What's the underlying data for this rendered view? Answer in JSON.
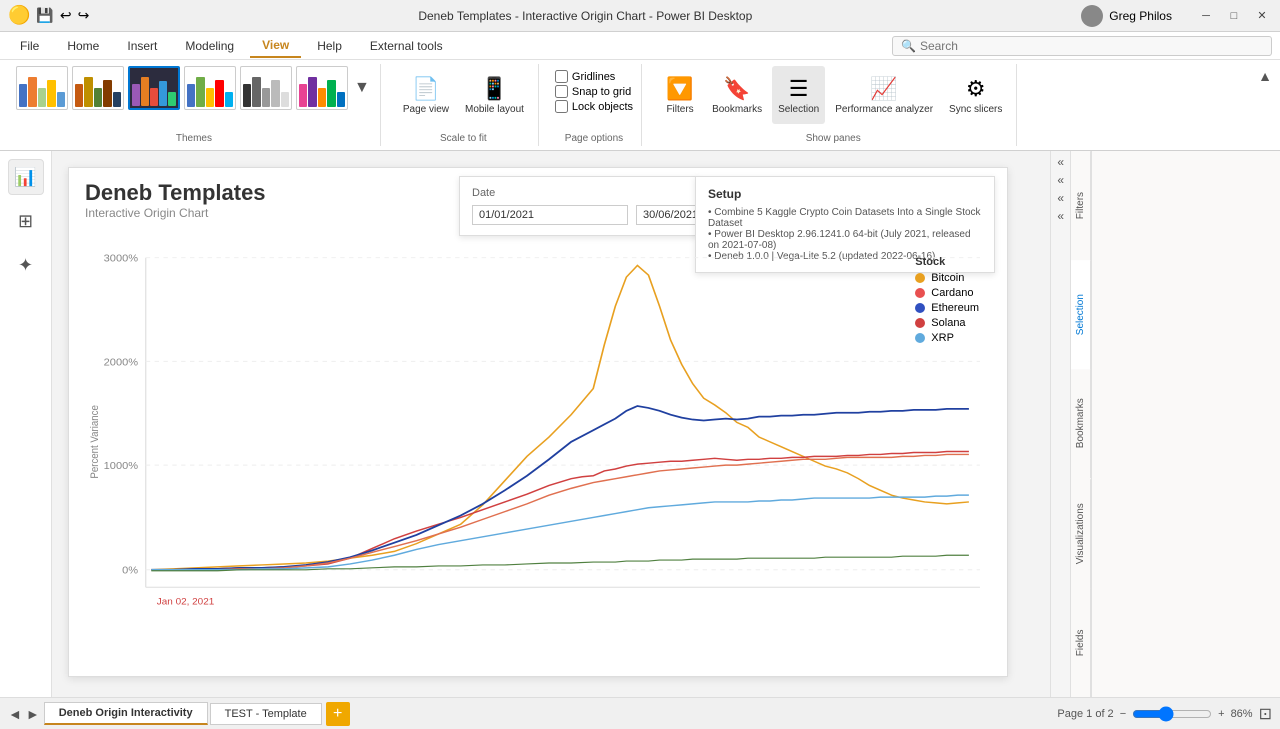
{
  "titleBar": {
    "title": "Deneb Templates - Interactive Origin Chart - Power BI Desktop",
    "user": "Greg Philos",
    "buttons": {
      "minimize": "─",
      "restore": "□",
      "close": "✕"
    }
  },
  "ribbon": {
    "tabs": [
      "File",
      "Home",
      "Insert",
      "Modeling",
      "View",
      "Help",
      "External tools"
    ],
    "activeTab": "View",
    "groups": {
      "themes": {
        "label": "Themes",
        "dropdown": "▼"
      },
      "scaleToFit": {
        "label": "Scale to fit",
        "buttons": [
          {
            "icon": "📄",
            "label": "Page\nview"
          },
          {
            "icon": "📱",
            "label": "Mobile\nlayout"
          }
        ]
      },
      "pageOptions": {
        "label": "Page options",
        "checkboxes": [
          "Gridlines",
          "Snap to grid",
          "Lock objects"
        ]
      },
      "showPanes": {
        "label": "Show panes",
        "buttons": [
          "Filters",
          "Bookmarks",
          "Selection",
          "Performance\nanalyzer",
          "Sync\nslicers"
        ]
      }
    }
  },
  "search": {
    "placeholder": "Search",
    "value": ""
  },
  "leftSidebar": {
    "icons": [
      "📊",
      "⊞",
      "✦"
    ]
  },
  "reportCanvas": {
    "title": "Deneb Templates",
    "subtitle": "Interactive Origin Chart",
    "datePanel": {
      "label": "Date",
      "startDate": "01/01/2021",
      "endDate": "30/06/2021"
    },
    "setupPanel": {
      "title": "Setup",
      "lines": [
        "• Combine 5 Kaggle Crypto Coin Datasets Into a Single Stock Dataset",
        "• Power BI Desktop 2.96.1241.0 64-bit (July 2021, released on 2021-07-08)",
        "• Deneb 1.0.0 | Vega-Lite 5.2 (updated 2022-06-16)"
      ]
    },
    "chart": {
      "yAxisLabel": "Percent Variance",
      "yTicks": [
        "3000%",
        "2000%",
        "1000%",
        "0%"
      ],
      "xLabel": "Jan 02, 2021"
    },
    "legend": {
      "title": "Stock",
      "items": [
        {
          "name": "Bitcoin",
          "color": "#e8a020"
        },
        {
          "name": "Cardano",
          "color": "#e85050"
        },
        {
          "name": "Ethereum",
          "color": "#3050c0"
        },
        {
          "name": "Solana",
          "color": "#d04040"
        },
        {
          "name": "XRP",
          "color": "#60aadd"
        }
      ]
    }
  },
  "bottomTabs": {
    "tabs": [
      "Deneb Origin Interactivity",
      "TEST - Template"
    ],
    "activeTab": "Deneb Origin Interactivity",
    "addBtn": "+"
  },
  "statusBar": {
    "page": "Page 1 of 2",
    "zoom": "86%"
  },
  "rightPanel": {
    "tabs": [
      "Filters",
      "Selection",
      "Bookmarks",
      "Visualizations",
      "Fields"
    ]
  }
}
